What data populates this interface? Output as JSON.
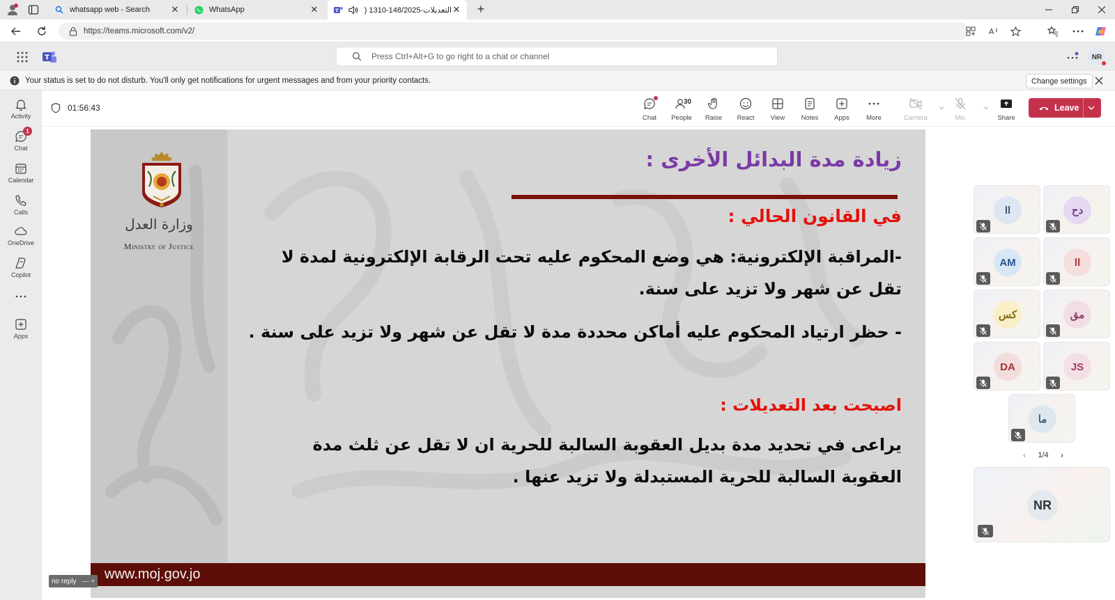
{
  "browser": {
    "tabs": [
      {
        "title": "whatsapp web - Search",
        "favicon": "search-icon"
      },
      {
        "title": "WhatsApp",
        "favicon": "whatsapp-icon"
      },
      {
        "title": "التعديلات-148/2025-1310 (1)",
        "favicon": "teams-icon",
        "active": true,
        "audio": true
      }
    ],
    "url": "https://teams.microsoft.com/v2/"
  },
  "teams": {
    "search_placeholder": "Press Ctrl+Alt+G to go right to a chat or channel",
    "me_initials": "NR",
    "banner_text": "Your status is set to do not disturb. You'll only get notifications for urgent messages and from your priority contacts.",
    "change_settings": "Change settings"
  },
  "rail": [
    {
      "label": "Activity",
      "icon": "bell-icon"
    },
    {
      "label": "Chat",
      "icon": "chat-icon",
      "badge": "1"
    },
    {
      "label": "Calendar",
      "icon": "calendar-icon"
    },
    {
      "label": "Calls",
      "icon": "phone-icon"
    },
    {
      "label": "OneDrive",
      "icon": "cloud-icon"
    },
    {
      "label": "Copilot",
      "icon": "copilot-icon"
    },
    {
      "label": "",
      "icon": "more-icon"
    },
    {
      "label": "Apps",
      "icon": "apps-icon"
    }
  ],
  "meeting": {
    "timer": "01:56:43",
    "tools": [
      {
        "label": "Chat"
      },
      {
        "label": "People",
        "count": "30"
      },
      {
        "label": "Raise"
      },
      {
        "label": "React"
      },
      {
        "label": "View"
      },
      {
        "label": "Notes"
      },
      {
        "label": "Apps"
      },
      {
        "label": "More"
      },
      {
        "label": "Camera"
      },
      {
        "label": "Mic"
      },
      {
        "label": "Share"
      }
    ],
    "leave": "Leave"
  },
  "slide": {
    "ministry_ar": "وزارة العدل",
    "ministry_en": "Ministry of Justice",
    "title": "زيادة مدة البدائل الأخرى :",
    "heading1": "في القانون الحالي :",
    "para1": "-المراقبة الإلكترونية: هي وضع المحكوم عليه تحت الرقابة الإلكترونية لمدة لا تقل عن شهر ولا تزيد على سنة.",
    "para2": "- حظر ارتياد المحكوم عليه أماكن محددة مدة لا تقل عن شهر ولا تزيد على سنة .",
    "heading2": "اصبحت بعد التعديلات :",
    "para3": "يراعى في تحديد مدة بديل العقوبة السالبة للحرية ان لا تقل عن ثلث مدة العقوبة السالبة للحرية المستبدلة ولا تزيد عنها .",
    "website": "www.moj.gov.jo",
    "colors": {
      "title": "#7a3aa6",
      "heading": "#e3120b",
      "footer": "#5e0e08"
    }
  },
  "presenter_label": "no reply",
  "participants": [
    {
      "initials": "دح",
      "bg": "#e4d9f0",
      "fg": "#6b3f8f"
    },
    {
      "initials": "ll",
      "bg": "#dde6f2",
      "fg": "#3b5a80"
    },
    {
      "initials": "ll",
      "bg": "#f5dede",
      "fg": "#b03a3a"
    },
    {
      "initials": "AM",
      "bg": "#d9e7f5",
      "fg": "#2a5590"
    },
    {
      "initials": "مق",
      "bg": "#f1dde6",
      "fg": "#8f3f60"
    },
    {
      "initials": "كس",
      "bg": "#f8efc8",
      "fg": "#8a6a10"
    },
    {
      "initials": "JS",
      "bg": "#f5dfe6",
      "fg": "#a03a60"
    },
    {
      "initials": "DA",
      "bg": "#f3dcdc",
      "fg": "#a03232"
    },
    {
      "initials": "ما",
      "bg": "#dde8ee",
      "fg": "#3a6070"
    }
  ],
  "pager": "1/4"
}
